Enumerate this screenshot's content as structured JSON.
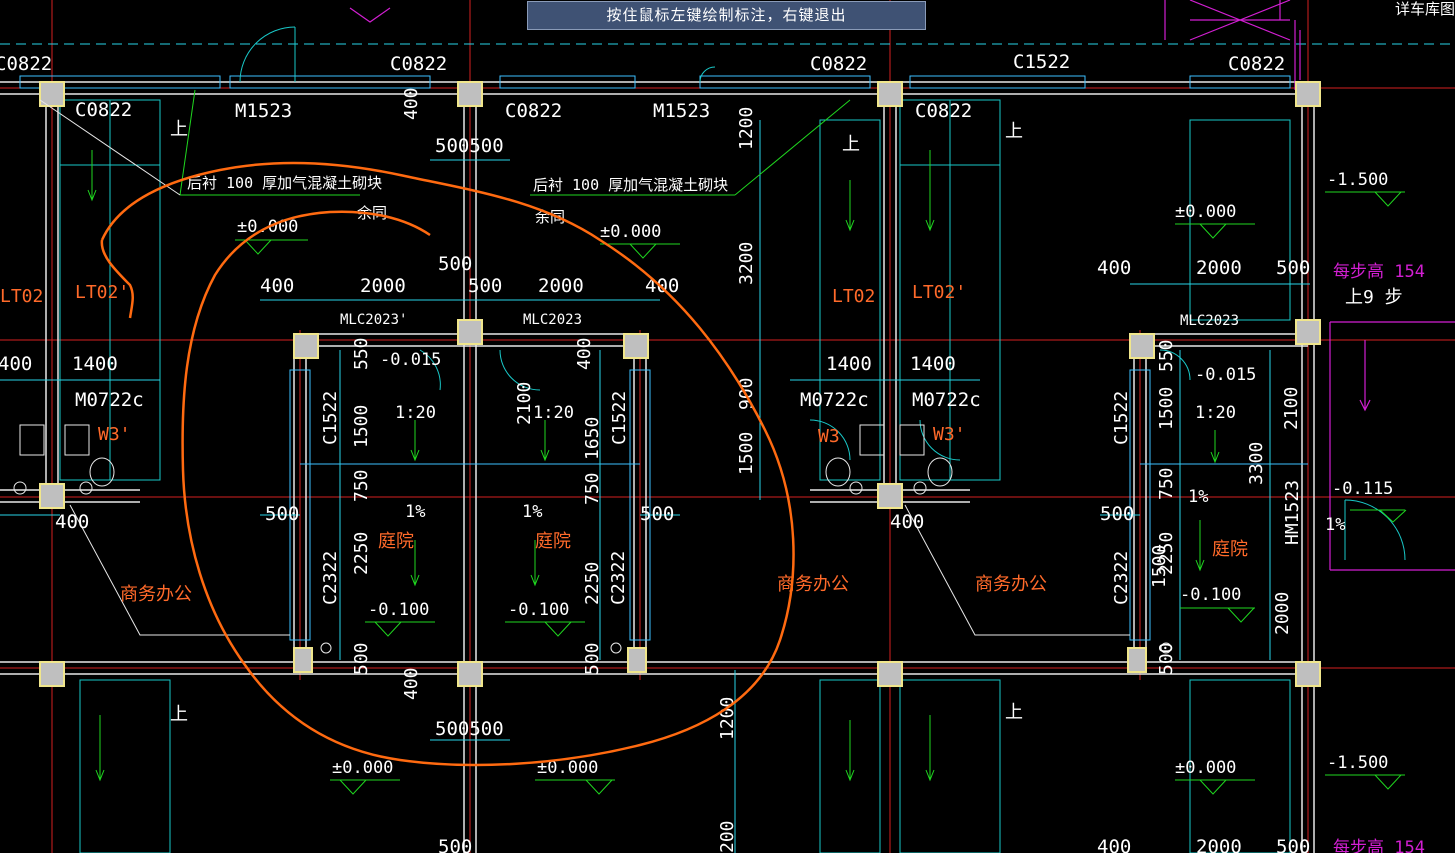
{
  "tooltip": "按住鼠标左键绘制标注，右键退出",
  "top_right_label": "详车库图纸",
  "colors": {
    "background": "#000000",
    "wall": "#e8e8e8",
    "axis": "#d42020",
    "dimension": "#29d4e8",
    "window": "#3cc0ff",
    "stair": "#19c8c8",
    "elevation": "#1fd61f",
    "room_label": "#ff6a2a",
    "annotation": "#ff6a10",
    "magenta": "#d21fd2",
    "column": "#f0e68c",
    "text": "#ffffff"
  },
  "notes": {
    "backfill_left": "后衬 100  厚加气混凝土砌块",
    "backfill_right": "后衬 100  厚加气混凝土砌块",
    "same_left": "余同",
    "same_right": "余同"
  },
  "openings": {
    "c0822_a": "C0822",
    "c0822_b": "C0822",
    "c0822_c": "C0822",
    "c0822_d": "C0822",
    "c0822_e": "C0822",
    "c0822_f": "C0822",
    "c0822_g": "C0822",
    "c1522_top": "C1522",
    "m1523_a": "M1523",
    "m1523_b": "M1523",
    "mlc2023p": "MLC2023'",
    "mlc2023_a": "MLC2023",
    "mlc2023_b": "MLC2023",
    "c1522_a": "C1522",
    "c1522_b": "C1522",
    "c1522_c": "C1522",
    "c2322_a": "C2322",
    "c2322_b": "C2322",
    "c2322_c": "C2322",
    "m0722c_l": "M0722c",
    "m0722c_a": "M0722c",
    "m0722c_b": "M0722c",
    "hm1523": "HM1523"
  },
  "labels": {
    "lt02_a": "LT02",
    "lt02p_a": "LT02'",
    "lt02_b": "LT02",
    "lt02p_b": "LT02'",
    "w3p_a": "W3'",
    "w3_b": "W3",
    "w3p_b": "W3'",
    "courtyard_a": "庭院",
    "courtyard_b": "庭院",
    "courtyard_c": "庭院",
    "office_a": "商务办公",
    "office_b": "商务办公",
    "office_c": "商务办公",
    "up_a": "上",
    "up_b": "上",
    "up_c": "上",
    "up_d": "上",
    "up_e": "上",
    "step_height": "每步高 154",
    "up_steps": "上9 步",
    "step_height_b": "每步高 154"
  },
  "elevations": {
    "e1": "±0.000",
    "e2": "±0.000",
    "e3": "±0.000",
    "e4": "±0.000",
    "e5": "±0.000",
    "e6": "±0.000",
    "n1500_a": "-1.500",
    "n1500_b": "-1.500",
    "n015_a": "-0.015",
    "n015_b": "-0.015",
    "n100_a": "-0.100",
    "n100_b": "-0.100",
    "n100_c": "-0.100",
    "n115": "-0.115",
    "slope_a": "1:20",
    "slope_b": "1:20",
    "slope_c": "1:20",
    "pct_a": "1%",
    "pct_b": "1%",
    "pct_c": "1%",
    "pct_d": "1%"
  },
  "dimensions": {
    "d400_a": "400",
    "d2000_a": "2000",
    "d500_a": "500",
    "d2000_b": "2000",
    "d400_b": "400",
    "d500_top": "500",
    "d500500_top": "500500",
    "d500500_bot": "500500",
    "d400_c": "400",
    "d2000_c": "2000",
    "d500_c": "500",
    "d400_l": "400",
    "d1400_l": "1400",
    "d1400_a": "1400",
    "d1400_b": "1400",
    "d550_a": "550",
    "d1500_a": "1500",
    "d750_a": "750",
    "d2250_a": "2250",
    "d500_a2": "500",
    "d400_v1": "400",
    "d2100_a": "2100",
    "d1650": "1650",
    "d750_b": "750",
    "d2250_b": "2250",
    "d500_b2": "500",
    "d500_h1": "500",
    "d500_h2": "500",
    "d500_h3": "500",
    "d400_h1": "400",
    "d400_h2": "400",
    "d1200_a": "1200",
    "d3200": "3200",
    "d900": "900",
    "d1500_b": "1500",
    "d1200_b": "1200",
    "d400_v2": "400",
    "d400_v3": "400",
    "d550_b": "550",
    "d1500_c": "1500",
    "d750_c": "750",
    "d2250_c": "2250",
    "d1500_d": "1500",
    "d500_c2": "500",
    "d2100_b": "2100",
    "d3300": "3300",
    "d2000_v": "2000",
    "d200_bot": "200",
    "d500_bl": "500",
    "d400_br": "400",
    "d2000_br": "2000",
    "d500_br": "500"
  }
}
